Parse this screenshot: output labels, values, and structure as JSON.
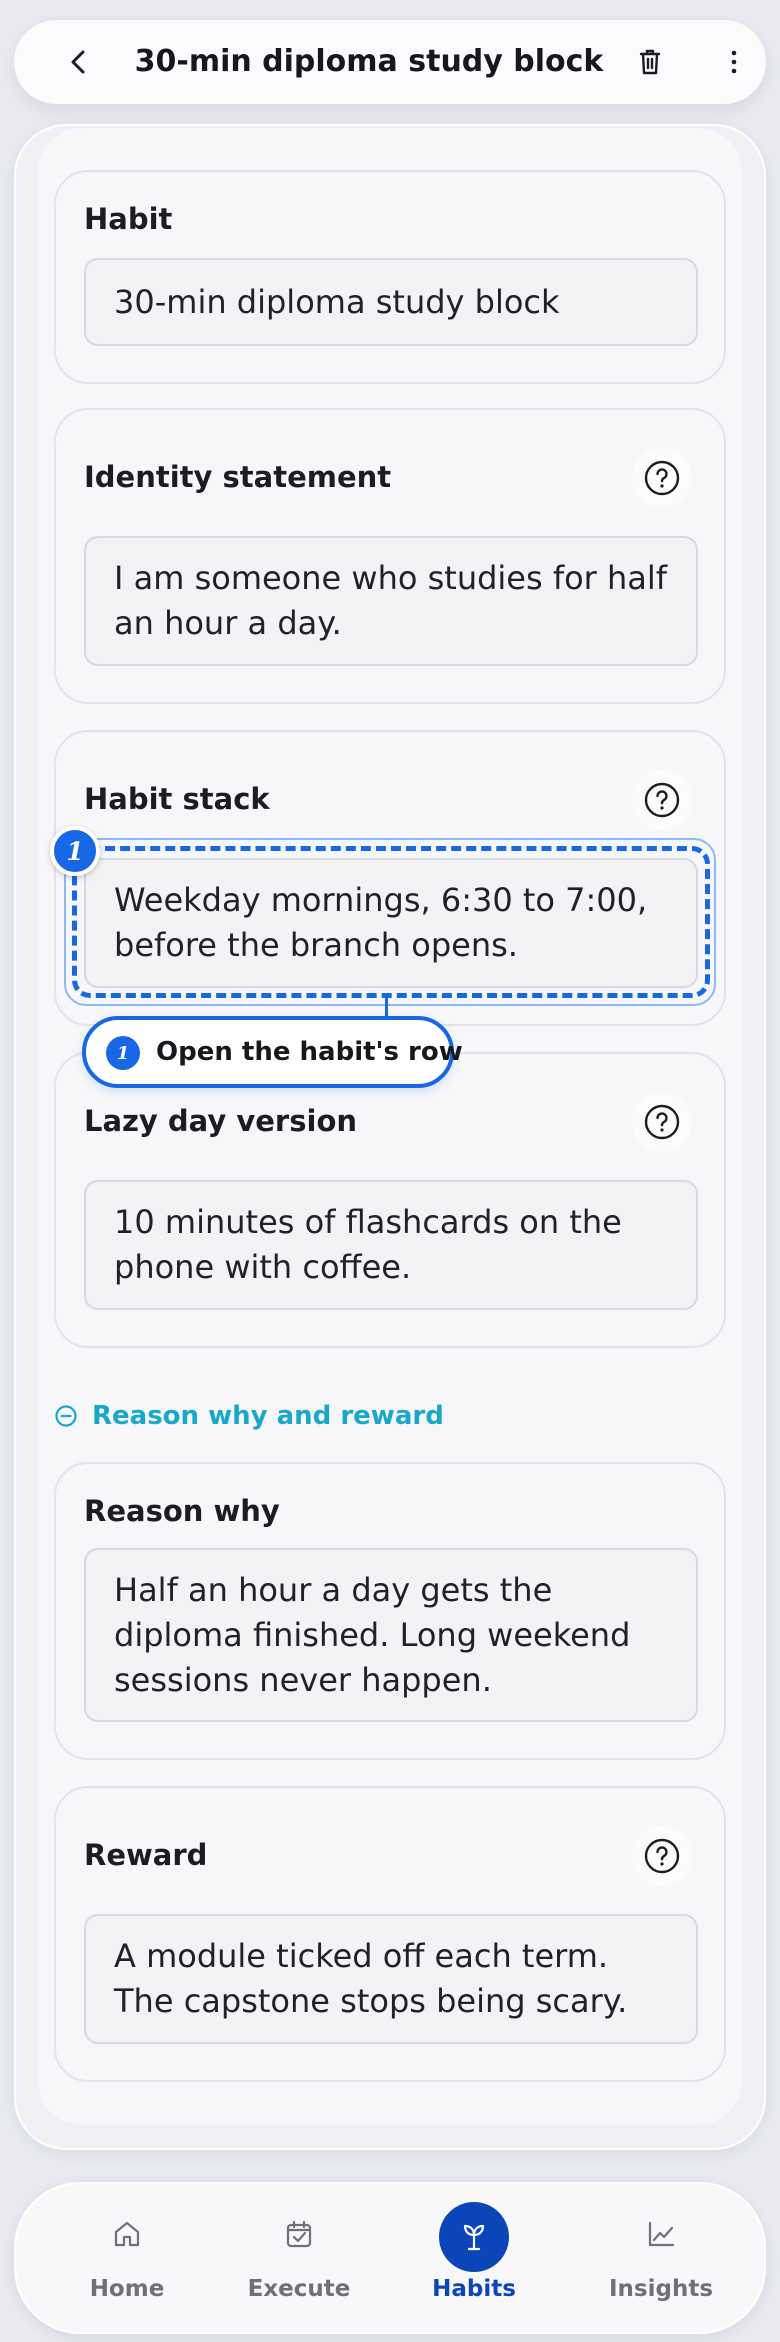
{
  "header": {
    "title": "30-min diploma study block",
    "back_icon": "chevron-left-icon",
    "delete_icon": "trash-icon",
    "more_icon": "more-vertical-icon"
  },
  "cards": {
    "habit": {
      "label": "Habit",
      "value": "30-min diploma study block"
    },
    "identity": {
      "label": "Identity statement",
      "value": "I am someone who studies for half an hour a day."
    },
    "stack": {
      "label": "Habit stack",
      "value": "Weekday mornings, 6:30 to 7:00, before the branch opens."
    },
    "lazy": {
      "label": "Lazy day version",
      "value": "10 minutes of flashcards on the phone with coffee."
    },
    "reason": {
      "label": "Reason why",
      "value": "Half an hour a day gets the diploma finished. Long weekend sessions never happen."
    },
    "reward": {
      "label": "Reward",
      "value": "A module ticked off each term. The capstone stops being scary."
    }
  },
  "section_toggle": {
    "label": "Reason why and reward",
    "icon": "minus-circle-icon"
  },
  "annotation": {
    "marker_number": "1",
    "callout_number": "1",
    "callout_text": "Open the habit's row"
  },
  "nav": {
    "items": [
      {
        "label": "Home",
        "icon": "home-icon"
      },
      {
        "label": "Execute",
        "icon": "calendar-check-icon"
      },
      {
        "label": "Habits",
        "icon": "sprout-icon",
        "active": true
      },
      {
        "label": "Insights",
        "icon": "trend-chart-icon"
      }
    ]
  },
  "colors": {
    "accent": "#0b46b8",
    "highlight": "#1767e6",
    "toggle": "#19a8c9"
  }
}
